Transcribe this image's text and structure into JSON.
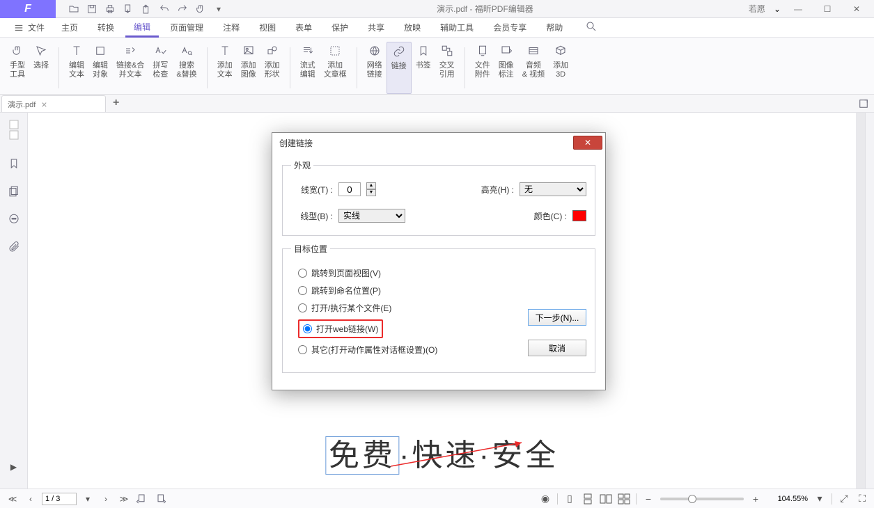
{
  "title_center": "演示.pdf - 福昕PDF编辑器",
  "user_name": "若愿",
  "menus": {
    "file": "文件",
    "items": [
      "主页",
      "转换",
      "编辑",
      "页面管理",
      "注释",
      "视图",
      "表单",
      "保护",
      "共享",
      "放映",
      "辅助工具",
      "会员专享",
      "帮助"
    ],
    "active_index": 2
  },
  "ribbon": {
    "groups": [
      [
        "手型\n工具",
        "选择"
      ],
      [
        "编辑\n文本",
        "编辑\n对象",
        "链接&合\n并文本",
        "拼写\n检查",
        "搜索\n&替换"
      ],
      [
        "添加\n文本",
        "添加\n图像",
        "添加\n形状"
      ],
      [
        "流式\n编辑",
        "添加\n文章框"
      ],
      [
        "网络\n链接",
        "链接",
        "书签",
        "交叉\n引用"
      ],
      [
        "文件\n附件",
        "图像\n标注",
        "音频\n& 视频",
        "添加\n3D"
      ]
    ],
    "highlight_label": "链接"
  },
  "doc_tab": "演示.pdf",
  "sidebar_icons": [
    "bookmark",
    "pages",
    "comment",
    "attach"
  ],
  "dialog": {
    "title": "创建链接",
    "appearance_legend": "外观",
    "line_width_label": "线宽(T) :",
    "line_width_value": "0",
    "highlight_label2": "高亮(H) :",
    "highlight_value": "无",
    "line_type_label": "线型(B) :",
    "line_type_value": "实线",
    "color_label": "颜色(C) :",
    "target_legend": "目标位置",
    "radios": [
      "跳转到页面视图(V)",
      "跳转到命名位置(P)",
      "打开/执行某个文件(E)",
      "打开web链接(W)",
      "其它(打开动作属性对话框设置)(O)"
    ],
    "selected_radio": 3,
    "next_btn": "下一步(N)...",
    "cancel_btn": "取消"
  },
  "big_text_parts": [
    "免费",
    "·快速·安全"
  ],
  "status": {
    "page_value": "1 / 3",
    "zoom": "104.55%"
  }
}
